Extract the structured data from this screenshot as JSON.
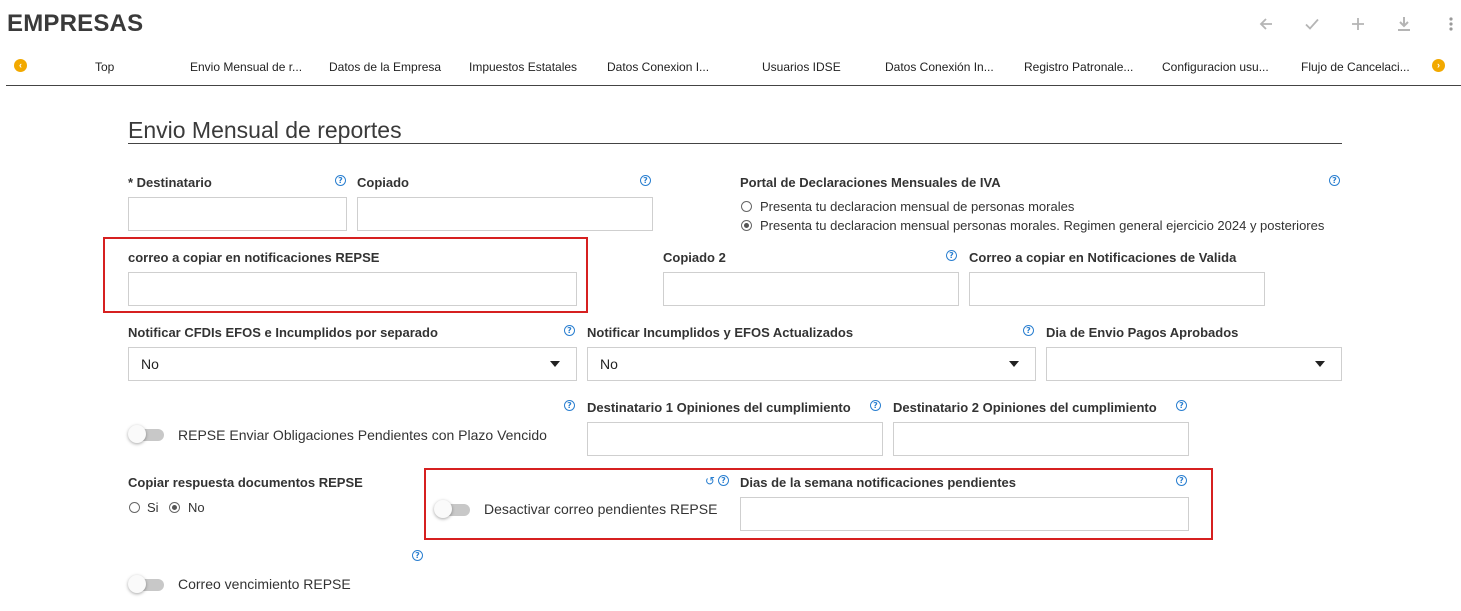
{
  "header": {
    "title": "EMPRESAS",
    "toolbar": {
      "back_icon": "arrow-left-icon",
      "check_icon": "check-icon",
      "add_icon": "plus-icon",
      "download_icon": "download-icon",
      "more_icon": "kebab-menu-icon"
    }
  },
  "tabs": [
    "Top",
    "Envio Mensual de r...",
    "Datos de la Empresa",
    "Impuestos Estatales",
    "Datos Conexion I...",
    "Usuarios IDSE",
    "Datos Conexión In...",
    "Registro Patronale...",
    "Configuracion usu...",
    "Flujo de Cancelaci..."
  ],
  "section": {
    "title": "Envio Mensual de reportes"
  },
  "form": {
    "destinatario_label": "* Destinatario",
    "destinatario_value": "",
    "copiado_label": "Copiado",
    "copiado_value": "",
    "portal_label": "Portal de Declaraciones Mensuales de IVA",
    "portal_options": [
      "Presenta tu declaracion mensual de personas morales",
      "Presenta tu declaracion mensual personas morales. Regimen general ejercicio 2024 y posteriores"
    ],
    "portal_selected_index": 1,
    "correo_repse_label": "correo a copiar en notificaciones REPSE",
    "correo_repse_value": "",
    "copiado2_label": "Copiado 2",
    "copiado2_value": "",
    "correo_valida_label": "Correo a copiar en Notificaciones de Valida",
    "correo_valida_value": "",
    "notificar_cfdis_label": "Notificar CFDIs EFOS e Incumplidos por separado",
    "notificar_cfdis_value": "No",
    "notificar_incumplidos_label": "Notificar Incumplidos y EFOS Actualizados",
    "notificar_incumplidos_value": "No",
    "dia_envio_label": "Dia de Envio Pagos Aprobados",
    "dia_envio_value": "",
    "repse_obligaciones_label": "REPSE Enviar Obligaciones Pendientes con Plazo Vencido",
    "destinatario1_label": "Destinatario 1 Opiniones del cumplimiento",
    "destinatario1_value": "",
    "destinatario2_label": "Destinatario 2 Opiniones del cumplimiento",
    "destinatario2_value": "",
    "copiar_respuesta_label": "Copiar respuesta documentos REPSE",
    "copiar_respuesta_si": "Si",
    "copiar_respuesta_no": "No",
    "copiar_respuesta_selected": "No",
    "desactivar_correo_label": "Desactivar correo pendientes REPSE",
    "dias_semana_label": "Dias de la semana notificaciones pendientes",
    "dias_semana_value": "",
    "correo_vencimiento_label": "Correo vencimiento REPSE"
  },
  "colors": {
    "accent_orange": "#f2a900",
    "help_blue": "#2a7fd0",
    "highlight_red": "#d62020"
  }
}
